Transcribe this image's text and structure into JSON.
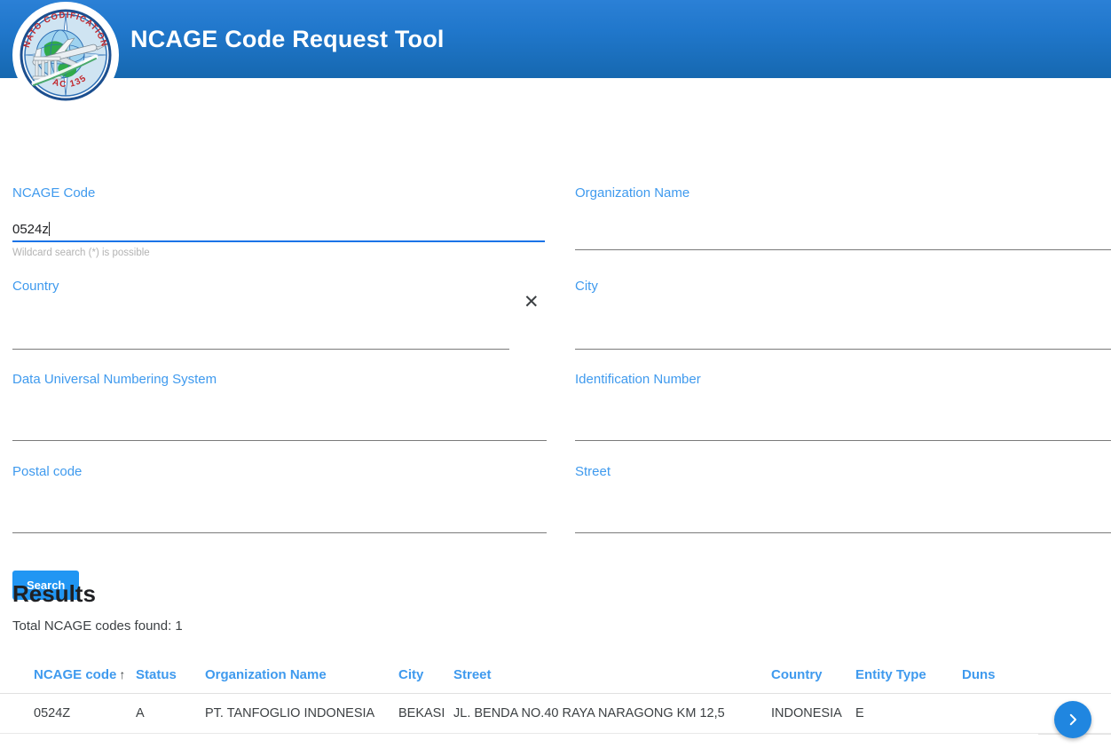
{
  "header": {
    "title": "NCAGE Code Request Tool",
    "logo_icon": "nato-codification-ac135-seal",
    "logo_text_top": "NATO CODIFICATION",
    "logo_text_bottom": "AC 135",
    "gradient_top": "#2b80d6",
    "gradient_bottom": "#1668b0"
  },
  "form": {
    "fields": [
      {
        "key": "ncage_code",
        "label": "NCAGE Code",
        "value": "0524z",
        "placeholder": "",
        "hint": "Wildcard search (*) is possible",
        "focused": true
      },
      {
        "key": "organization_name",
        "label": "Organization Name",
        "value": "",
        "placeholder": "",
        "hint": "",
        "focused": false
      },
      {
        "key": "country",
        "label": "Country",
        "value": "",
        "placeholder": "",
        "hint": "",
        "focused": false,
        "clear_icon": "close-icon",
        "clear_glyph": "✕"
      },
      {
        "key": "city",
        "label": "City",
        "value": "",
        "placeholder": "",
        "hint": "",
        "focused": false
      },
      {
        "key": "duns",
        "label": "Data Universal Numbering System",
        "value": "",
        "placeholder": "",
        "hint": "",
        "focused": false
      },
      {
        "key": "identification_number",
        "label": "Identification Number",
        "value": "",
        "placeholder": "",
        "hint": "",
        "focused": false
      },
      {
        "key": "postal_code",
        "label": "Postal code",
        "value": "",
        "placeholder": "",
        "hint": "",
        "focused": false
      },
      {
        "key": "street",
        "label": "Street",
        "value": "",
        "placeholder": "",
        "hint": "",
        "focused": false
      }
    ],
    "search_button_label": "Search"
  },
  "results": {
    "title": "Results",
    "count_text": "Total NCAGE codes found: 1",
    "sort_column": "NCAGE code",
    "sort_direction_glyph": "↑",
    "columns": [
      "NCAGE code",
      "Status",
      "Organization Name",
      "City",
      "Street",
      "Country",
      "Entity Type",
      "Duns"
    ],
    "rows": [
      {
        "ncage_code": "0524Z",
        "status": "A",
        "organization_name": "PT. TANFOGLIO INDONESIA",
        "city": "BEKASI",
        "street": "JL. BENDA NO.40 RAYA NARAGONG KM 12,5",
        "country": "INDONESIA",
        "entity_type": "E",
        "duns": ""
      }
    ]
  },
  "fab": {
    "icon": "chevron-right-icon",
    "color": "#2086e0"
  },
  "colors": {
    "accent": "#3f9aee",
    "primary": "#2196f3",
    "focus_underline": "#1a73e8",
    "text": "#3c4043"
  }
}
